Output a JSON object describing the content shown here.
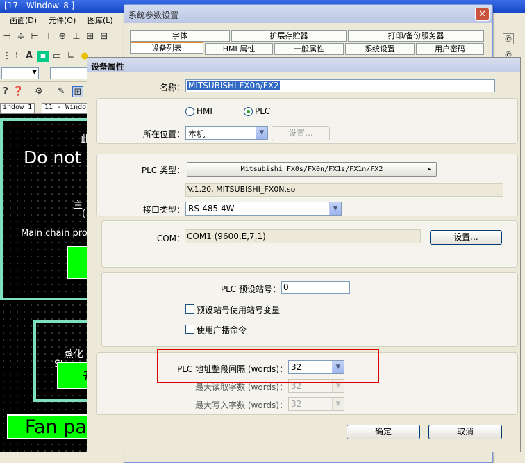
{
  "bg_window": {
    "title": "[17 - Window_8 ]",
    "menu": [
      "画面(D)",
      "元件(O)",
      "图库(L)"
    ],
    "tabs": [
      "indow_1",
      "11 - Windo"
    ],
    "canvas": {
      "text_ci": "此",
      "text_do_not": "Do not",
      "text_zhu": "主",
      "text_paren": "(",
      "text_main_chain": "Main chain prot",
      "text_zhenghua": "蒸化",
      "text_steaming": "Steami",
      "text_hash": "#",
      "text_fan": "Fan pa"
    }
  },
  "sys_dialog": {
    "title": "系统参数设置",
    "close": "✕",
    "tabs_row1": [
      "字体",
      "扩展存贮器",
      "打印/备份服务器"
    ],
    "tabs_row2": [
      "设备列表",
      "HMI 属性",
      "一般属性",
      "系统设置",
      "用户密码"
    ]
  },
  "dev_dialog": {
    "title": "设备属性",
    "name_label": "名称：",
    "name_value": "MITSUBISHI FX0n/FX2",
    "radio_hmi": "HMI",
    "radio_plc": "PLC",
    "location_label": "所在位置：",
    "location_value": "本机",
    "location_settings": "设置...",
    "plc_type_label": "PLC 类型：",
    "plc_type_value": "Mitsubishi FX0s/FX0n/FX1s/FX1n/FX2",
    "plc_type_arrow": "▸",
    "driver_version": "V.1.20, MITSUBISHI_FX0N.so",
    "interface_label": "接口类型：",
    "interface_value": "RS-485 4W",
    "com_label": "COM：",
    "com_value": "COM1 (9600,E,7,1)",
    "com_settings": "设置...",
    "station_label": "PLC 预设站号：",
    "station_value": "0",
    "check_station_var": "预设站号使用站号变量",
    "check_broadcast": "使用广播命令",
    "addr_interval_label": "PLC 地址整段间隔 (words)：",
    "addr_interval_value": "32",
    "max_read_label": "最大读取字数 (words)：",
    "max_read_value": "32",
    "max_write_label": "最大写入字数 (words)：",
    "max_write_value": "32",
    "ok": "确定",
    "cancel": "取消"
  },
  "colors": {
    "highlight_box": "#e00000",
    "canvas_green": "#00ff00",
    "frame_teal": "#7fe0c0"
  }
}
